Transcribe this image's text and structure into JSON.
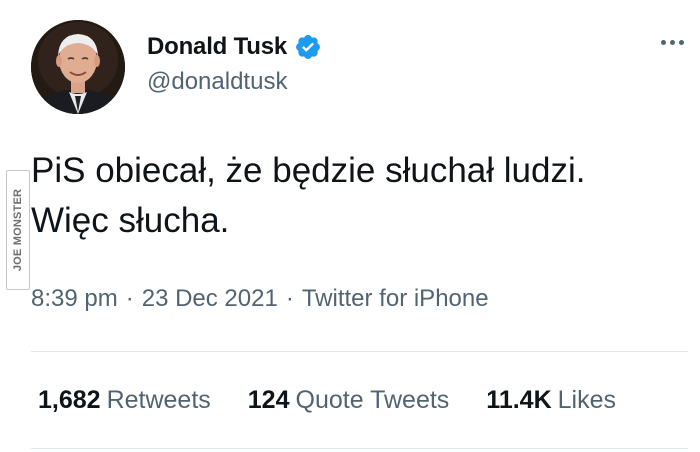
{
  "colors": {
    "text_primary": "#0f1419",
    "text_secondary": "#536471",
    "verified_badge": "#1d9bf0",
    "divider": "#e1e8ed"
  },
  "author": {
    "display_name": "Donald Tusk",
    "handle": "@donaldtusk",
    "verified": true,
    "avatar_icon": "profile-photo"
  },
  "tweet": {
    "text": "PiS obiecał, że będzie słuchał ludzi. Więc słucha.",
    "time": "8:39 pm",
    "date": "23 Dec 2021",
    "source": "Twitter for iPhone",
    "separator": "·"
  },
  "stats": {
    "retweets": {
      "count": "1,682",
      "label": "Retweets"
    },
    "quote_tweets": {
      "count": "124",
      "label": "Quote Tweets"
    },
    "likes": {
      "count": "11.4K",
      "label": "Likes"
    }
  },
  "watermark": "JOE MONSTER",
  "menu_icon": "more-options-icon"
}
